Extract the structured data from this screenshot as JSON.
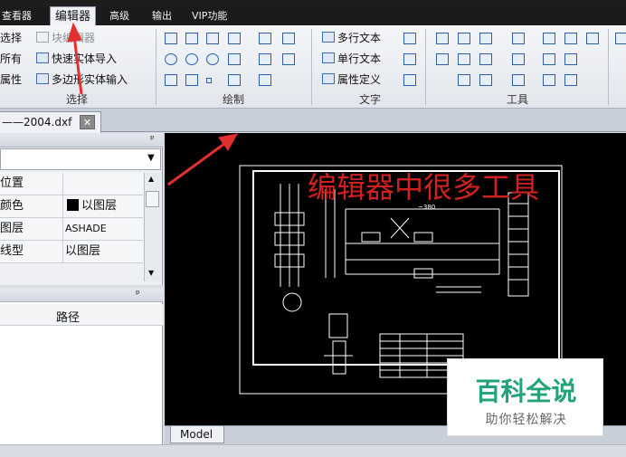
{
  "menu": {
    "items": [
      "查看器",
      "编辑器",
      "高级",
      "输出",
      "VIP功能"
    ]
  },
  "ribbon": {
    "select_group": {
      "items": [
        "选择",
        "所有",
        "属性"
      ],
      "label": "选择",
      "block_editor": "块编辑器",
      "quick_import": "快速实体导入",
      "polygon_input": "多边形实体输入"
    },
    "draw_group": {
      "label": "绘制"
    },
    "text_group": {
      "mtext": "多行文本",
      "stext": "单行文本",
      "attdef": "属性定义",
      "label": "文字"
    },
    "tools_group": {
      "label": "工具"
    }
  },
  "document_tab": {
    "label": "——2004.dxf",
    "close": "✕"
  },
  "properties": {
    "rows": [
      {
        "key": "位置",
        "value": ""
      },
      {
        "key": "颜色",
        "value": "以图层"
      },
      {
        "key": "图层",
        "value": "ASHADE"
      },
      {
        "key": "线型",
        "value": "以图层"
      }
    ],
    "pin": "ᵖ"
  },
  "path_panel": {
    "column": "路径",
    "pin": "ᵖ"
  },
  "canvas": {
    "annotation": "编辑器中很多工具",
    "drawing_small": "~380"
  },
  "model_tab": {
    "label": "Model"
  },
  "watermark": {
    "title": "百科全说",
    "subtitle": "助你轻松解决"
  },
  "colors": {
    "annotation": "#d02020",
    "watermark": "#23a37a",
    "arrow": "#e23030"
  }
}
